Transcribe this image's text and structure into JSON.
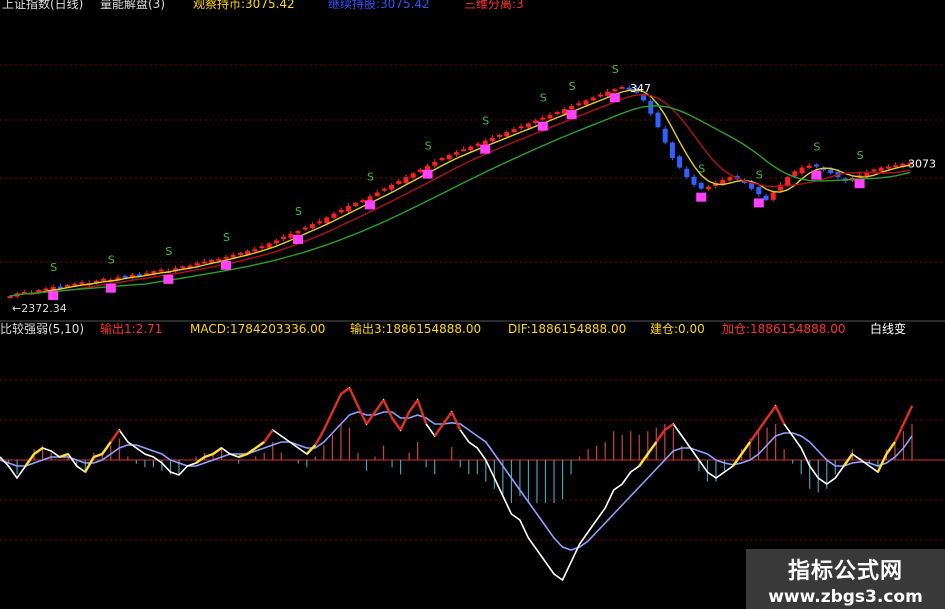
{
  "header_top": {
    "title": "上证指数(日线)",
    "indicator": "量能解盘(3)",
    "hold_label": "观察持币:3075.42",
    "mid_label": "继续持股:3075.42",
    "right_label": "三维分离:3"
  },
  "header_bottom": {
    "name": "比较强弱(5,10)",
    "out": "输出1:2.71",
    "macd": "MACD:1784203336.00",
    "out2": "输出3:1886154888.00",
    "dif": "DIF:1886154888.00",
    "hold": "建仓:0.00",
    "jia": "加仓:1886154888.00",
    "right": "白线变"
  },
  "watermark": {
    "line1": "指标公式网",
    "line2": "www.zbgs3.com"
  },
  "colors": {
    "up": "#ff2020",
    "down": "#3060ff",
    "signal": "#ff40ff",
    "ma_green": "#2aa02a",
    "ma_red": "#b01020",
    "ma_yellow": "#e0d020",
    "macd_white": "#ffffff",
    "macd_blue": "#8fa0ff",
    "grid": "#7a0000"
  },
  "chart_data": [
    {
      "type": "candlestick",
      "series_name": "上证指数(日线)",
      "low_label": "←2372.34",
      "high_label": "347",
      "last_label": "3073",
      "close": [
        2380,
        2395,
        2402,
        2398,
        2412,
        2420,
        2428,
        2425,
        2438,
        2445,
        2452,
        2448,
        2460,
        2470,
        2466,
        2478,
        2485,
        2492,
        2488,
        2500,
        2510,
        2518,
        2512,
        2525,
        2535,
        2540,
        2552,
        2560,
        2568,
        2575,
        2585,
        2595,
        2605,
        2615,
        2625,
        2640,
        2655,
        2670,
        2690,
        2705,
        2720,
        2738,
        2755,
        2770,
        2790,
        2810,
        2830,
        2850,
        2865,
        2880,
        2900,
        2920,
        2940,
        2960,
        2980,
        3000,
        3020,
        3040,
        3060,
        3080,
        3100,
        3115,
        3130,
        3145,
        3160,
        3175,
        3190,
        3205,
        3220,
        3235,
        3250,
        3265,
        3280,
        3295,
        3310,
        3325,
        3340,
        3355,
        3370,
        3385,
        3400,
        3415,
        3430,
        3445,
        3458,
        3470,
        3460,
        3440,
        3400,
        3330,
        3260,
        3180,
        3100,
        3050,
        3000,
        2960,
        2940,
        2950,
        2970,
        2985,
        3000,
        2990,
        2970,
        2940,
        2910,
        2880,
        2920,
        2960,
        3000,
        3030,
        3050,
        3060,
        3055,
        3040,
        3020,
        3000,
        2980,
        2995,
        3010,
        3025,
        3040,
        3050,
        3055,
        3062,
        3070,
        3075
      ]
    },
    {
      "type": "macd",
      "series_name": "比较强弱(5,10)",
      "series": [
        {
          "name": "white",
          "values": [
            0.05,
            -0.1,
            -0.3,
            -0.1,
            0.1,
            0.2,
            0.15,
            0.05,
            0.1,
            -0.1,
            -0.2,
            0.05,
            0.1,
            0.3,
            0.5,
            0.3,
            0.2,
            0.1,
            0.05,
            -0.05,
            -0.2,
            -0.25,
            -0.1,
            -0.05,
            0.05,
            0.1,
            0.2,
            0.1,
            0.05,
            0.1,
            0.2,
            0.3,
            0.5,
            0.4,
            0.3,
            0.2,
            0.1,
            0.25,
            0.5,
            0.8,
            1.1,
            1.2,
            0.9,
            0.6,
            0.8,
            1.0,
            0.7,
            0.5,
            0.8,
            1.0,
            0.6,
            0.4,
            0.6,
            0.8,
            0.5,
            0.3,
            0.2,
            0.0,
            -0.3,
            -0.6,
            -0.9,
            -1.0,
            -1.3,
            -1.5,
            -1.7,
            -1.9,
            -2.0,
            -1.7,
            -1.4,
            -1.2,
            -1.0,
            -0.8,
            -0.5,
            -0.4,
            -0.2,
            -0.1,
            0.1,
            0.3,
            0.5,
            0.6,
            0.4,
            0.2,
            0.0,
            -0.2,
            -0.3,
            -0.2,
            -0.1,
            0.1,
            0.3,
            0.5,
            0.7,
            0.9,
            0.6,
            0.4,
            0.2,
            -0.1,
            -0.3,
            -0.4,
            -0.3,
            -0.1,
            0.1,
            0.0,
            -0.1,
            -0.2,
            0.1,
            0.3,
            0.6,
            0.9
          ]
        },
        {
          "name": "blue",
          "values": [
            0.0,
            -0.05,
            -0.1,
            -0.1,
            -0.05,
            0.0,
            0.05,
            0.05,
            0.05,
            0.0,
            -0.05,
            -0.05,
            0.0,
            0.1,
            0.2,
            0.25,
            0.25,
            0.2,
            0.15,
            0.1,
            0.0,
            -0.05,
            -0.1,
            -0.1,
            -0.05,
            0.0,
            0.05,
            0.1,
            0.1,
            0.1,
            0.15,
            0.2,
            0.25,
            0.3,
            0.3,
            0.25,
            0.2,
            0.2,
            0.3,
            0.45,
            0.6,
            0.75,
            0.8,
            0.75,
            0.75,
            0.8,
            0.8,
            0.7,
            0.7,
            0.75,
            0.7,
            0.6,
            0.6,
            0.62,
            0.6,
            0.5,
            0.4,
            0.3,
            0.1,
            -0.1,
            -0.3,
            -0.5,
            -0.7,
            -0.9,
            -1.1,
            -1.3,
            -1.45,
            -1.5,
            -1.45,
            -1.35,
            -1.2,
            -1.05,
            -0.9,
            -0.75,
            -0.6,
            -0.45,
            -0.3,
            -0.15,
            0.0,
            0.15,
            0.2,
            0.2,
            0.15,
            0.1,
            0.0,
            -0.05,
            -0.08,
            -0.05,
            0.0,
            0.1,
            0.25,
            0.4,
            0.45,
            0.45,
            0.4,
            0.3,
            0.15,
            0.0,
            -0.1,
            -0.1,
            -0.05,
            -0.03,
            -0.05,
            -0.1,
            -0.05,
            0.05,
            0.2,
            0.4
          ]
        }
      ]
    }
  ]
}
